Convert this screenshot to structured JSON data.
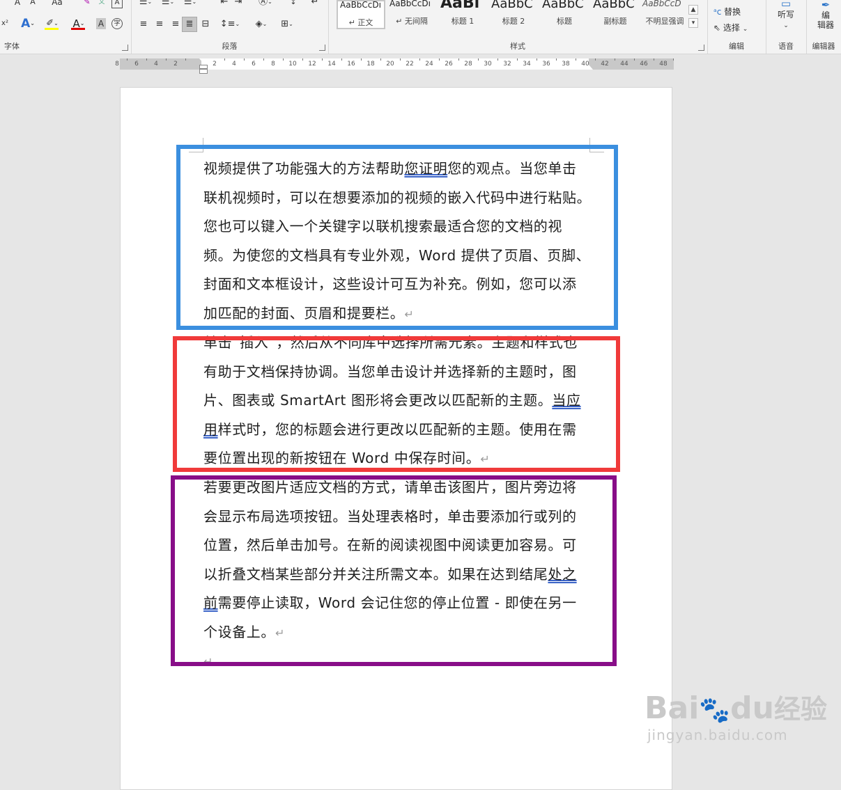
{
  "ribbon": {
    "groups": {
      "font": "字体",
      "paragraph": "段落",
      "styles": "样式",
      "editing": "编辑",
      "voice": "语音",
      "editor": "编辑器"
    },
    "font_buttons": {
      "grow": "A",
      "shrink": "A",
      "case": "Aa",
      "superscript": "x²",
      "char_border": "A",
      "phonetic": "文"
    },
    "colors": {
      "highlight": "#ffff00",
      "font_color": "#e00000",
      "accent": "#2b579a"
    },
    "styles": [
      {
        "sample": "AaBbCcDı",
        "name": "↵ 正文",
        "selected": true
      },
      {
        "sample": "AaBbCcDı",
        "name": "↵ 无间隔",
        "selected": false
      },
      {
        "sample": "AaBl",
        "name": "标题 1",
        "selected": false
      },
      {
        "sample": "AaBbC",
        "name": "标题 2",
        "selected": false
      },
      {
        "sample": "AaBbC",
        "name": "标题",
        "selected": false
      },
      {
        "sample": "AaBbC",
        "name": "副标题",
        "selected": false
      },
      {
        "sample": "AaBbCcD",
        "name": "不明显强调",
        "selected": false
      }
    ],
    "editing": {
      "replace": "替换",
      "select": "选择"
    },
    "voice": {
      "dictate": "听写"
    },
    "editor": {
      "label_line1": "编",
      "label_line2": "辑器"
    }
  },
  "ruler": {
    "ticks": [
      "8",
      "6",
      "4",
      "2",
      "",
      "2",
      "4",
      "6",
      "8",
      "10",
      "12",
      "14",
      "16",
      "18",
      "20",
      "22",
      "24",
      "26",
      "28",
      "30",
      "32",
      "34",
      "36",
      "38",
      "40",
      "42",
      "44",
      "46",
      "48"
    ]
  },
  "document": {
    "paragraph1": [
      {
        "parts": [
          {
            "t": "视频提供了功能强大的方法帮助"
          },
          {
            "t": "您证明",
            "u": true
          },
          {
            "t": "您的观点。当您单击"
          }
        ]
      },
      {
        "parts": [
          {
            "t": "联机视频时，可以在想要添加的视频的嵌入代码中进行粘贴。"
          }
        ]
      },
      {
        "parts": [
          {
            "t": "您也可以键入一个关键字以联机搜索最适合您的文档的视"
          }
        ]
      },
      {
        "parts": [
          {
            "t": "频。为使您的文档具有专业外观，Word  提供了页眉、页脚、"
          }
        ]
      },
      {
        "parts": [
          {
            "t": "封面和文本框设计，这些设计可互为补充。例如，您可以添"
          }
        ]
      },
      {
        "parts": [
          {
            "t": "加匹配的封面、页眉和提要栏。"
          },
          {
            "t": "↵",
            "pm": true
          }
        ]
      }
    ],
    "paragraph2": [
      {
        "parts": [
          {
            "t": "单击“插入”，然后从不同库中选择所需元素。主题和样式也"
          }
        ]
      },
      {
        "parts": [
          {
            "t": "有助于文档保持协调。当您单击设计并选择新的主题时，图"
          }
        ]
      },
      {
        "parts": [
          {
            "t": "片、图表或  SmartArt  图形将会更改以匹配新的主题。"
          },
          {
            "t": "当应",
            "u": true
          }
        ]
      },
      {
        "parts": [
          {
            "t": "用",
            "u": true
          },
          {
            "t": "样式时，您的标题会进行更改以匹配新的主题。使用在需"
          }
        ]
      },
      {
        "parts": [
          {
            "t": "要位置出现的新按钮在  Word  中保存时间。"
          },
          {
            "t": "↵",
            "pm": true
          }
        ]
      }
    ],
    "paragraph3": [
      {
        "parts": [
          {
            "t": "若要更改图片适应文档的方式，请单击该图片，图片旁边将"
          }
        ]
      },
      {
        "parts": [
          {
            "t": "会显示布局选项按钮。当处理表格时，单击要添加行或列的"
          }
        ]
      },
      {
        "parts": [
          {
            "t": "位置，然后单击加号。在新的阅读视图中阅读更加容易。可"
          }
        ]
      },
      {
        "parts": [
          {
            "t": "以折叠文档某些部分并关注所需文本。如果在达到结尾"
          },
          {
            "t": "处之",
            "u": true
          }
        ]
      },
      {
        "parts": [
          {
            "t": "前",
            "u": true
          },
          {
            "t": "需要停止读取，Word  会记住您的停止位置  -  即使在另一"
          }
        ]
      },
      {
        "parts": [
          {
            "t": "个设备上。"
          },
          {
            "t": "↵",
            "pm": true
          }
        ]
      }
    ],
    "trailing_mark": "↵"
  },
  "annotations": {
    "box1_color": "#3b8fdf",
    "box2_color": "#f03a3a",
    "box3_color": "#880e88"
  },
  "watermark": {
    "brand": "Bai",
    "brand2": "du",
    "cn": "经验",
    "url": "jingyan.baidu.com"
  }
}
